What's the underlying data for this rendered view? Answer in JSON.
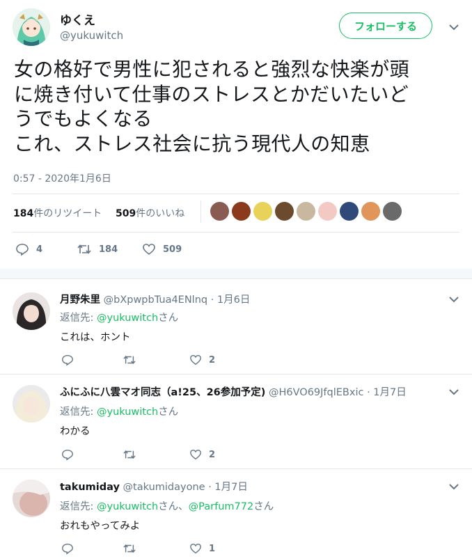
{
  "main_tweet": {
    "display_name": "ゆくえ",
    "handle": "@yukuwitch",
    "follow_label": "フォローする",
    "text_lines": [
      "女の格好で男性に犯されると強烈な快楽が頭",
      "に焼き付いて仕事のストレスとかだいたいど",
      "うでもよくなる",
      "これ、ストレス社会に抗う現代人の知恵"
    ],
    "timestamp": "0:57 - 2020年1月6日",
    "retweet_count": "184",
    "retweet_suffix": "件のリツイート",
    "like_count": "509",
    "like_suffix": "件のいいね",
    "actions": {
      "reply": "4",
      "retweet": "184",
      "like": "509"
    },
    "liker_colors": [
      "#8a5b52",
      "#8b3a1e",
      "#e8d25a",
      "#6b4a2e",
      "#c8b8a0",
      "#f3c9c4",
      "#2f4a7a",
      "#e0955a",
      "#6a6a6a"
    ]
  },
  "replies": [
    {
      "name": "月野朱里",
      "handle": "@bXpwpbTua4ENlnq",
      "date": "· 1月6日",
      "reply_prefix": "返信先: ",
      "reply_to": "@yukuwitch",
      "reply_to_suffix": "さん",
      "text": "これは、ホント",
      "likes": "2"
    },
    {
      "name": "ふにふに八雲マオ同志（a!25、26参加予定)",
      "handle": "@H6VO69JfqlEBxic",
      "date": "· 1月7日",
      "reply_prefix": "返信先: ",
      "reply_to": "@yukuwitch",
      "reply_to_suffix": "さん",
      "text": "わかる",
      "likes": "2"
    },
    {
      "name": "takumiday",
      "handle": "@takumidayone",
      "date": "· 1月7日",
      "reply_prefix": "返信先: ",
      "reply_to": "@yukuwitch",
      "reply_to_suffix": "さん、",
      "reply_to2": "@Parfum772",
      "reply_to2_suffix": "さん",
      "text": "おれもやってみよ",
      "likes": "1"
    }
  ]
}
